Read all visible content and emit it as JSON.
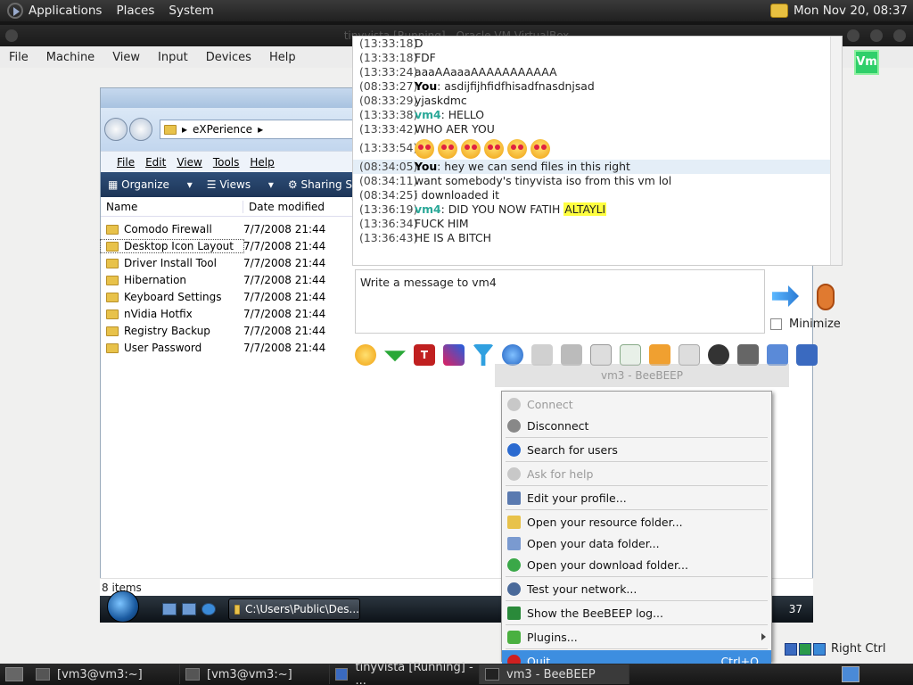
{
  "top_panel": {
    "menus": [
      "Applications",
      "Places",
      "System"
    ],
    "clock": "Mon Nov 20, 08:37"
  },
  "vbox": {
    "title": "tinyvista [Running] - Oracle VM VirtualBox",
    "menus": [
      "File",
      "Machine",
      "View",
      "Input",
      "Devices",
      "Help"
    ],
    "badge": "Vm",
    "host_key": "Right Ctrl"
  },
  "explorer": {
    "path": "eXPerience",
    "menus": [
      "File",
      "Edit",
      "View",
      "Tools",
      "Help"
    ],
    "toolbar": [
      "Organize",
      "Views",
      "Sharing Setti"
    ],
    "columns": [
      "Name",
      "Date modified"
    ],
    "files": [
      {
        "name": "Comodo Firewall",
        "date": "7/7/2008 21:44"
      },
      {
        "name": "Desktop Icon Layout",
        "date": "7/7/2008 21:44"
      },
      {
        "name": "Driver Install Tool",
        "date": "7/7/2008 21:44"
      },
      {
        "name": "Hibernation",
        "date": "7/7/2008 21:44"
      },
      {
        "name": "Keyboard Settings",
        "date": "7/7/2008 21:44"
      },
      {
        "name": "nVidia Hotfix",
        "date": "7/7/2008 21:44"
      },
      {
        "name": "Registry Backup",
        "date": "7/7/2008 21:44"
      },
      {
        "name": "User Password",
        "date": "7/7/2008 21:44"
      }
    ],
    "status": "8 items",
    "taskbar_button": "C:\\Users\\Public\\Des...",
    "clock_fragment": "37"
  },
  "chat": {
    "messages": [
      {
        "time": "(13:33:18)",
        "sender": "",
        "text": "D"
      },
      {
        "time": "(13:33:18)",
        "sender": "",
        "text": "FDF"
      },
      {
        "time": "(13:33:24)",
        "sender": "",
        "text": "aaaAAaaaAAAAAAAAAAA"
      },
      {
        "time": "(08:33:27)",
        "sender": "You",
        "text": ": asdijfijhfidfhisadfnasdnjsad"
      },
      {
        "time": "(08:33:29)",
        "sender": "",
        "text": "yjaskdmc"
      },
      {
        "time": "(13:33:38)",
        "sender": "vm4",
        "text": ": HELLO"
      },
      {
        "time": "(13:33:42)",
        "sender": "",
        "text": "WHO AER YOU"
      },
      {
        "time": "(13:33:54)",
        "sender": "",
        "text": "",
        "emoji_count": 6
      },
      {
        "time": "(08:34:05)",
        "sender": "You",
        "text": ": hey we can send files in this right"
      },
      {
        "time": "(08:34:11)",
        "sender": "",
        "text": "want somebody's tinyvista iso from this vm lol"
      },
      {
        "time": "(08:34:25)",
        "sender": "",
        "text": "i downloaded it"
      },
      {
        "time": "(13:36:19)",
        "sender": "vm4",
        "text": ": DID YOU NOW FATIH ",
        "highlight": "ALTAYLI"
      },
      {
        "time": "(13:36:34)",
        "sender": "",
        "text": "FUCK HIM"
      },
      {
        "time": "(13:36:43)",
        "sender": "",
        "text": "HE IS A BITCH"
      }
    ],
    "input_placeholder": "Write a message to vm4",
    "minimize_label": "Minimize",
    "ghost_title": "vm3 - BeeBEEP"
  },
  "context_menu": {
    "items": [
      {
        "label": "Connect",
        "enabled": false,
        "icon": "connect-icon"
      },
      {
        "label": "Disconnect",
        "enabled": true,
        "icon": "disconnect-icon"
      },
      {
        "label": "Search for users",
        "enabled": true,
        "icon": "search-users-icon"
      },
      {
        "label": "Ask for help",
        "enabled": false,
        "icon": "help-icon"
      },
      {
        "label": "Edit your profile...",
        "enabled": true,
        "icon": "profile-icon"
      },
      {
        "label": "Open your resource folder...",
        "enabled": true,
        "icon": "folder-icon"
      },
      {
        "label": "Open your data folder...",
        "enabled": true,
        "icon": "data-folder-icon"
      },
      {
        "label": "Open your download folder...",
        "enabled": true,
        "icon": "download-icon"
      },
      {
        "label": "Test your network...",
        "enabled": true,
        "icon": "network-icon"
      },
      {
        "label": "Show the BeeBEEP log...",
        "enabled": true,
        "icon": "log-icon"
      },
      {
        "label": "Plugins...",
        "enabled": true,
        "icon": "plugin-icon"
      },
      {
        "label": "Quit",
        "enabled": true,
        "icon": "quit-icon",
        "shortcut": "Ctrl+Q"
      }
    ]
  },
  "bottom_taskbar": [
    {
      "label": "[vm3@vm3:~]",
      "active": false
    },
    {
      "label": "[vm3@vm3:~]",
      "active": false
    },
    {
      "label": "tinyvista [Running] - ...",
      "active": false
    },
    {
      "label": "vm3 - BeeBEEP",
      "active": true
    }
  ]
}
